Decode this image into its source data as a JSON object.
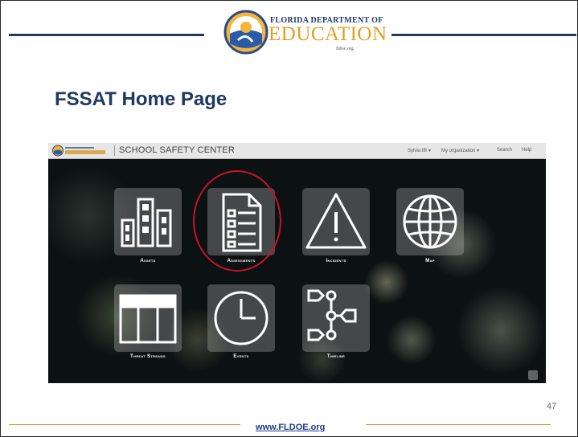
{
  "header": {
    "org_line1": "FLORIDA DEPARTMENT OF",
    "org_line2": "EDUCATION",
    "org_site": "fldoe.org",
    "logo_icon": "fldoe-seal-icon"
  },
  "slide": {
    "title": "FSSAT Home Page",
    "page_number": "47"
  },
  "app": {
    "name": "SCHOOL SAFETY CENTER",
    "nav": {
      "user": "Sylvia Ilfr ▾",
      "organization": "My organization ▾",
      "search": "Search",
      "help": "Help"
    },
    "tiles": [
      {
        "label": "Assets",
        "icon": "buildings-icon"
      },
      {
        "label": "Assessments",
        "icon": "checklist-icon"
      },
      {
        "label": "Incidents",
        "icon": "warning-icon"
      },
      {
        "label": "Map",
        "icon": "globe-icon"
      },
      {
        "label": "Threat Streams",
        "icon": "table-icon"
      },
      {
        "label": "Events",
        "icon": "clock-icon"
      },
      {
        "label": "Timeline",
        "icon": "flow-icon"
      }
    ],
    "highlight_color": "#c8102e"
  },
  "footer": {
    "url": "www.FLDOE.org"
  },
  "colors": {
    "brand_navy": "#1f3864",
    "brand_gold": "#e0a020"
  }
}
